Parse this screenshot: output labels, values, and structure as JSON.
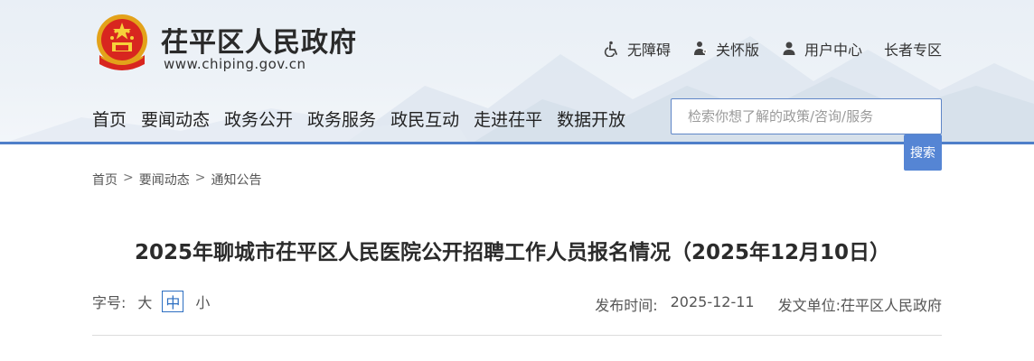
{
  "site": {
    "title": "茌平区人民政府",
    "url": "www.chiping.gov.cn"
  },
  "top_links": [
    {
      "label": "无障碍",
      "icon": "wheelchair-icon"
    },
    {
      "label": "关怀版",
      "icon": "care-icon"
    },
    {
      "label": "用户中心",
      "icon": "user-icon"
    },
    {
      "label": "长者专区"
    }
  ],
  "nav": [
    "首页",
    "要闻动态",
    "政务公开",
    "政务服务",
    "政民互动",
    "走进茌平",
    "数据开放"
  ],
  "search": {
    "placeholder": "检索你想了解的政策/咨询/服务",
    "button": "搜索"
  },
  "breadcrumb": [
    "首页",
    "要闻动态",
    "通知公告"
  ],
  "breadcrumb_sep": ">",
  "article": {
    "title": "2025年聊城市茌平区人民医院公开招聘工作人员报名情况（2025年12月10日）",
    "font_size_label": "字号:",
    "font_sizes": [
      "大",
      "中",
      "小"
    ],
    "publish_label": "发布时间:",
    "publish_date": "2025-12-11",
    "issuer_label": "发文单位:",
    "issuer": "茌平区人民政府"
  },
  "colors": {
    "accent": "#4f7fc9",
    "search_button": "#5585d4",
    "active_font": "#2d6fc2"
  }
}
